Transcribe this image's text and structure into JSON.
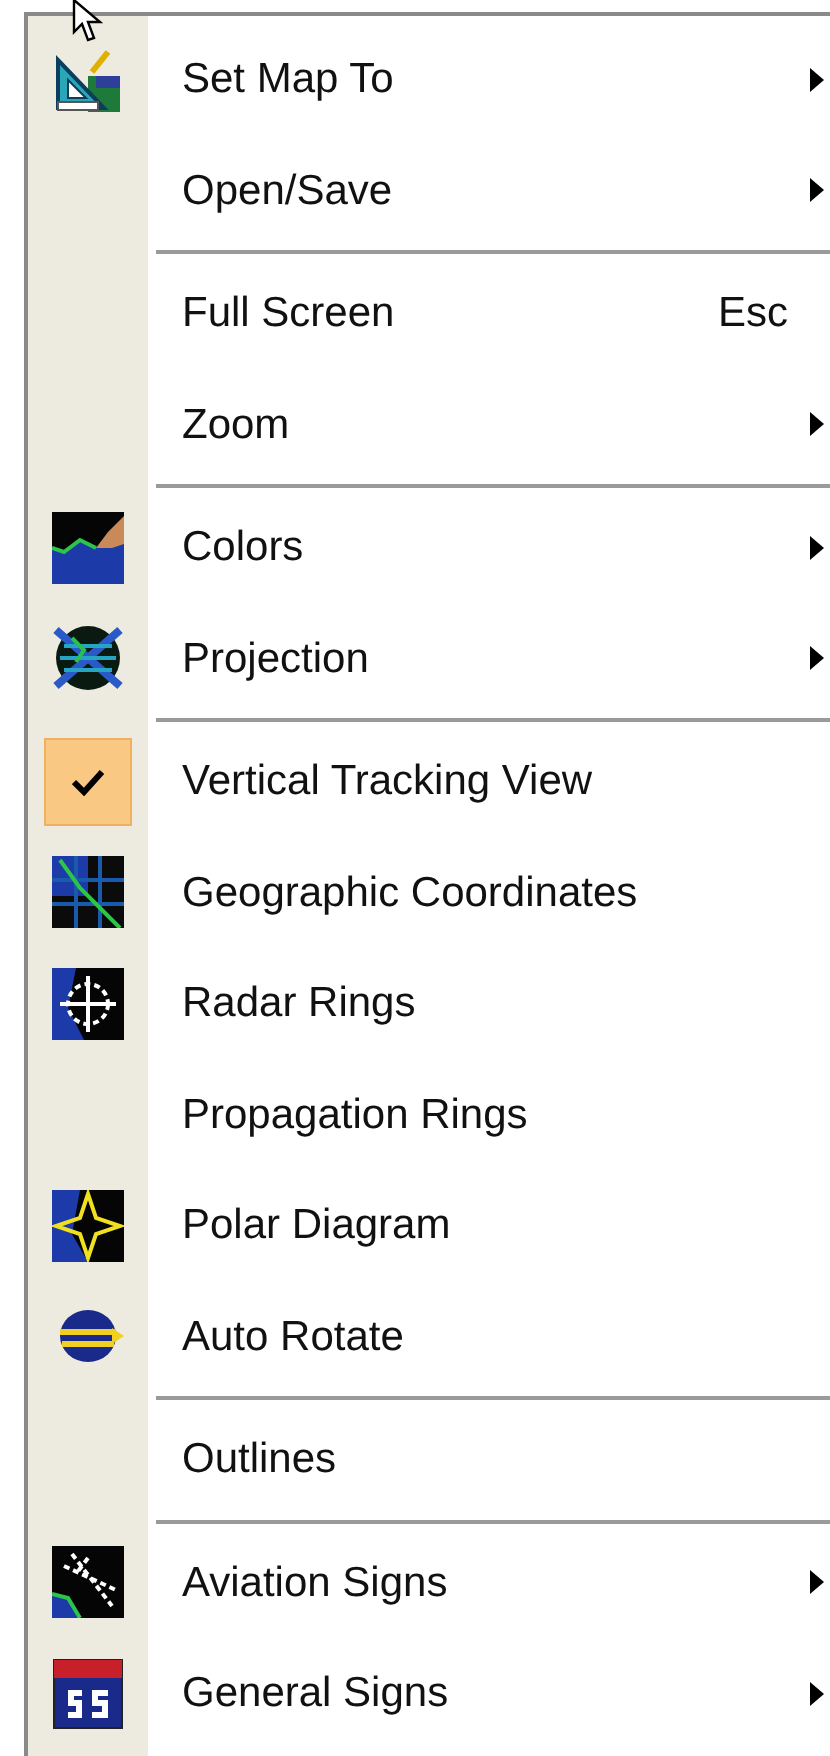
{
  "menu": {
    "items": [
      {
        "kind": "item",
        "label": "Set Map To",
        "submenu": true,
        "checked": false
      },
      {
        "kind": "item",
        "label": "Open/Save",
        "submenu": true,
        "checked": false
      },
      {
        "kind": "separator"
      },
      {
        "kind": "item",
        "label": "Full Screen",
        "shortcut": "Esc",
        "submenu": false,
        "checked": false
      },
      {
        "kind": "item",
        "label": "Zoom",
        "submenu": true,
        "checked": false
      },
      {
        "kind": "separator"
      },
      {
        "kind": "item",
        "label": "Colors",
        "submenu": true,
        "checked": false
      },
      {
        "kind": "item",
        "label": "Projection",
        "submenu": true,
        "checked": false
      },
      {
        "kind": "separator"
      },
      {
        "kind": "item",
        "label": "Vertical Tracking View",
        "submenu": false,
        "checked": true
      },
      {
        "kind": "item",
        "label": "Geographic Coordinates",
        "submenu": false,
        "checked": false
      },
      {
        "kind": "item",
        "label": "Radar Rings",
        "submenu": false,
        "checked": false
      },
      {
        "kind": "item",
        "label": "Propagation Rings",
        "submenu": false,
        "checked": false
      },
      {
        "kind": "item",
        "label": "Polar Diagram",
        "submenu": false,
        "checked": false
      },
      {
        "kind": "item",
        "label": "Auto Rotate",
        "submenu": false,
        "checked": false
      },
      {
        "kind": "separator"
      },
      {
        "kind": "item",
        "label": "Outlines",
        "submenu": false,
        "checked": false
      },
      {
        "kind": "separator"
      },
      {
        "kind": "item",
        "label": "Aviation Signs",
        "submenu": true,
        "checked": false
      },
      {
        "kind": "item",
        "label": "General Signs",
        "submenu": true,
        "checked": false
      }
    ]
  }
}
